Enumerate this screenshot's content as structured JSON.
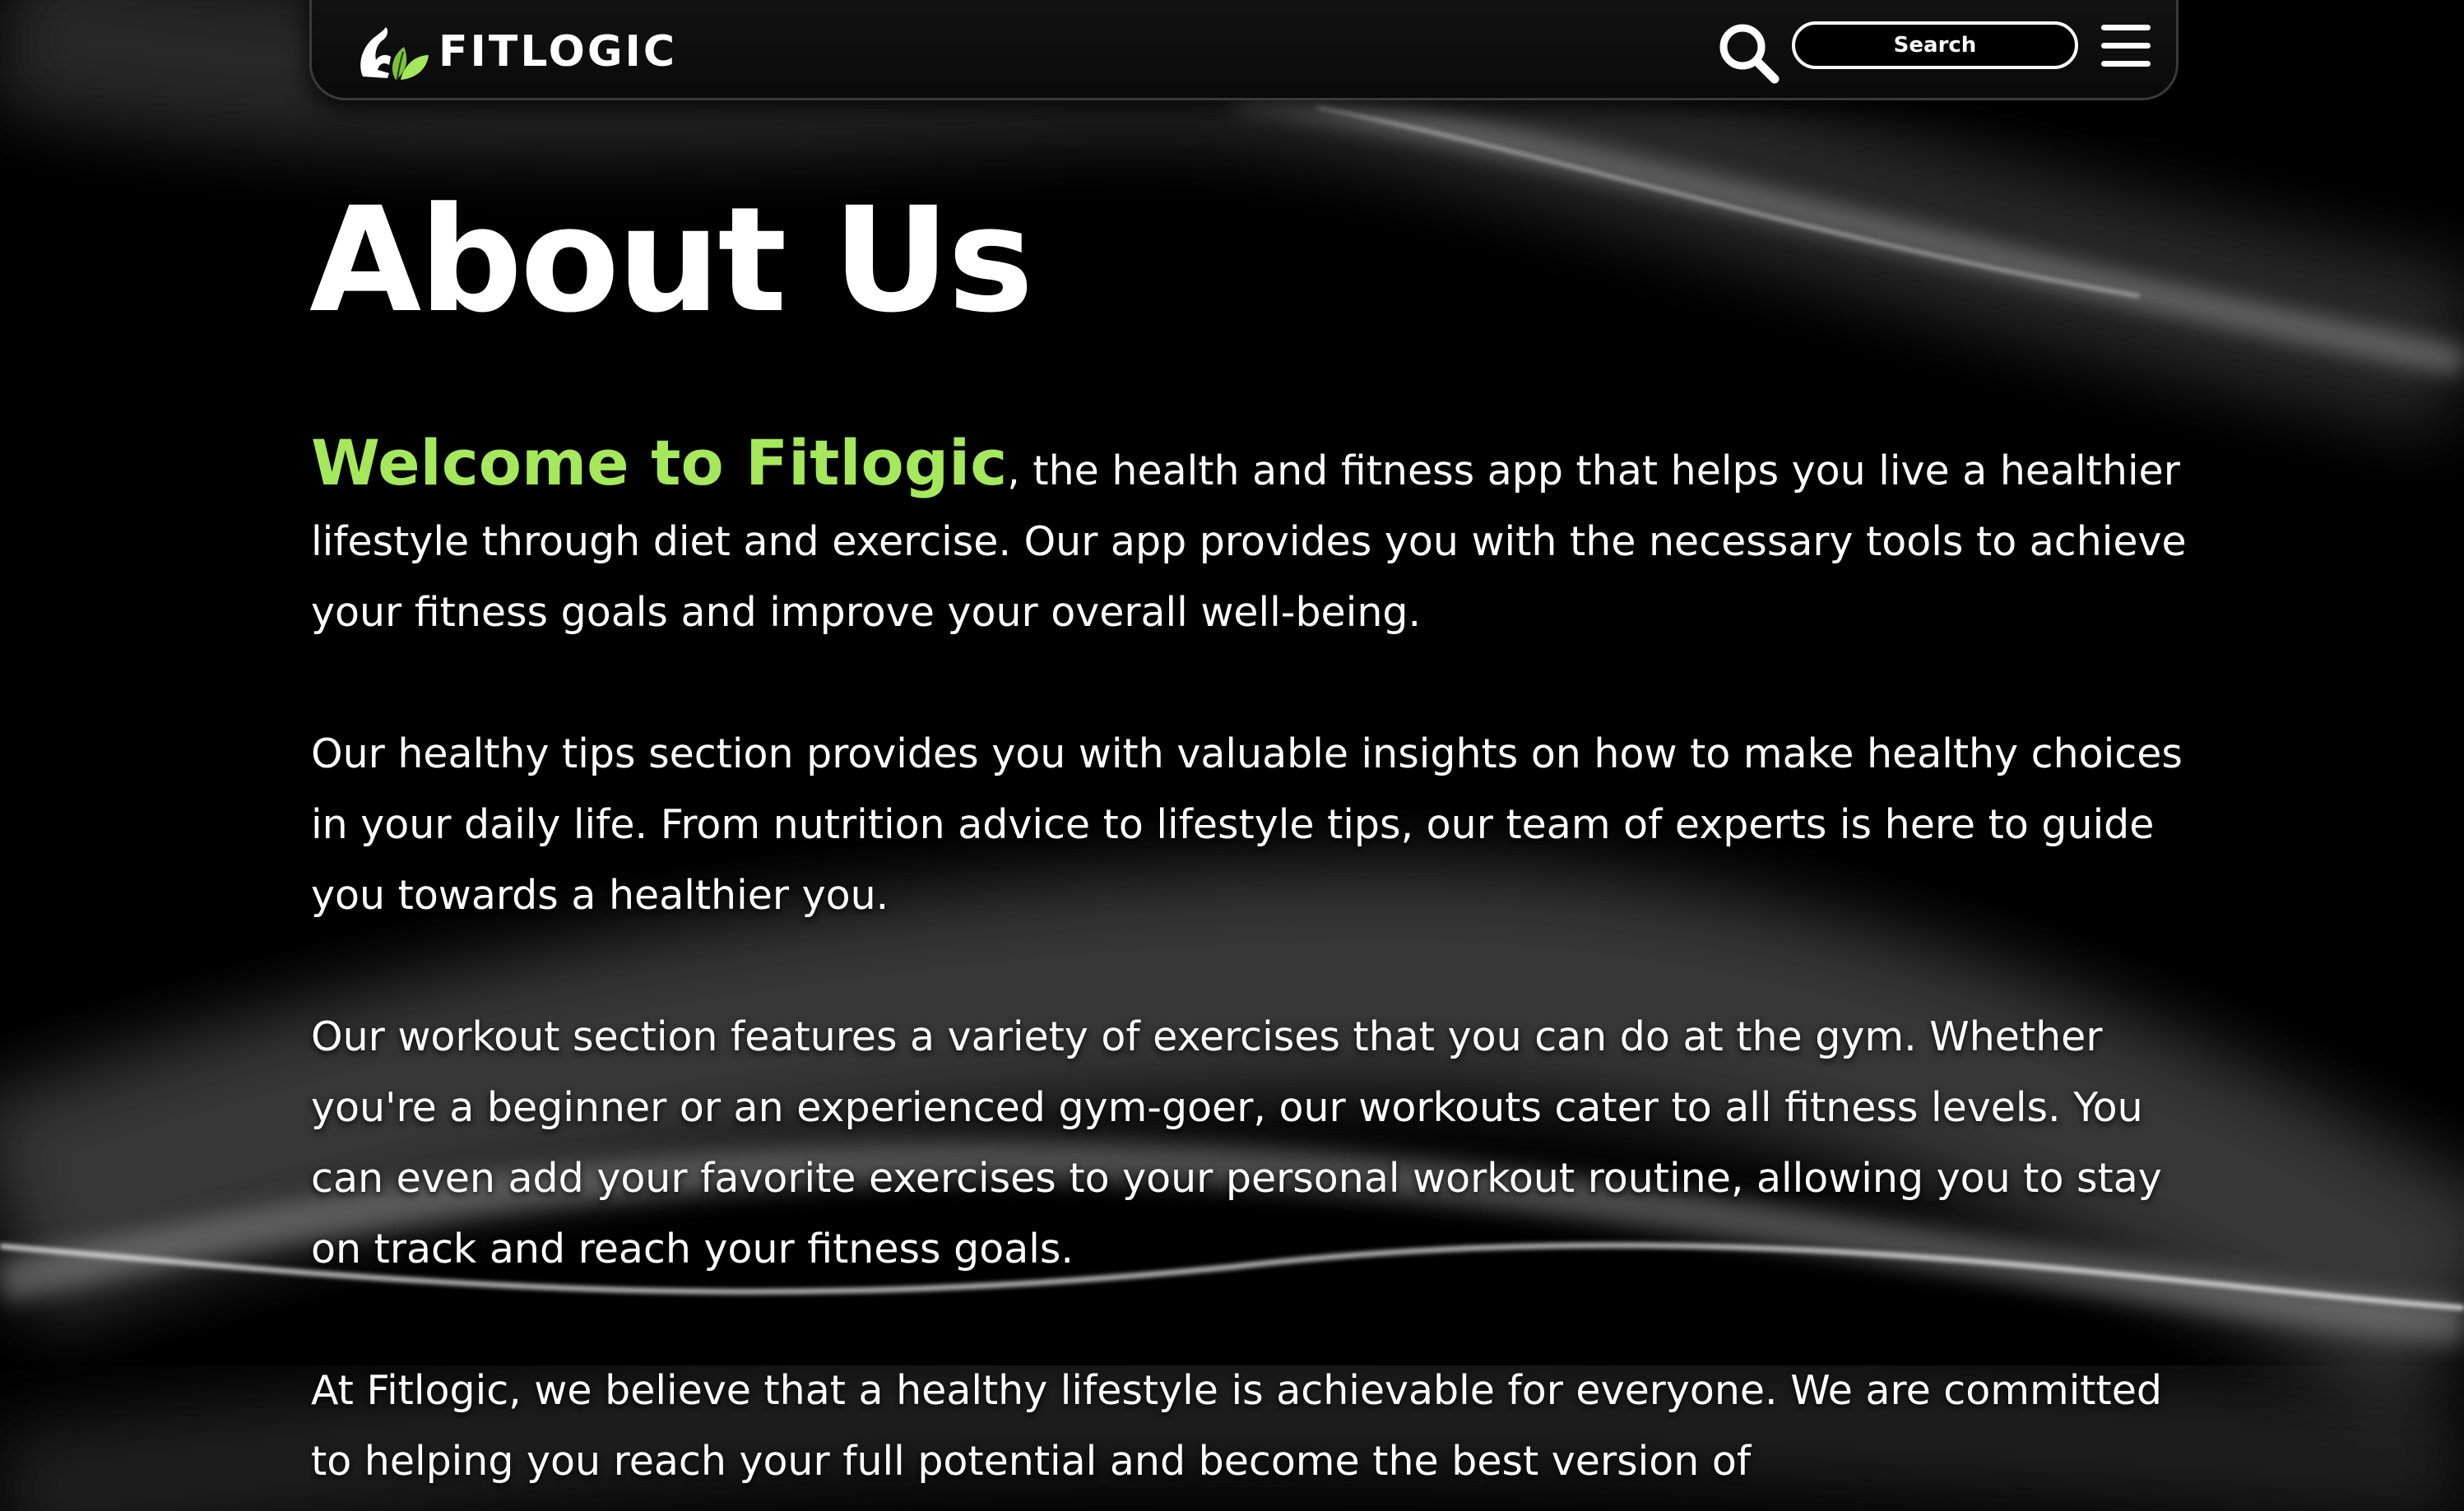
{
  "header": {
    "brand": "FITLOGIC",
    "search_placeholder": "Search",
    "icons": {
      "logo": "flexed-arm-leaf-logo",
      "search": "search-icon",
      "menu": "hamburger-menu-icon"
    }
  },
  "main": {
    "title": "About Us",
    "intro_highlight": "Welcome to Fitlogic",
    "intro_rest": ", the health and fitness app that helps you live a healthier lifestyle through diet and exercise. Our app provides you with the necessary tools to achieve your fitness goals and improve your overall well-being.",
    "paragraphs": [
      "Our healthy tips section provides you with valuable insights on how to make healthy choices in your daily life. From nutrition advice to lifestyle tips, our team of experts is here to guide you towards a healthier you.",
      "Our workout section features a variety of exercises that you can do at the gym. Whether you're a beginner or an experienced gym-goer, our workouts cater to all fitness levels. You can even add your favorite exercises to your personal workout routine, allowing you to stay on track and reach your fitness goals.",
      "At Fitlogic, we believe that a healthy lifestyle is achievable for everyone. We are committed to helping you reach your full potential and become the best version of"
    ]
  },
  "colors": {
    "background": "#000000",
    "text": "#ffffff",
    "accent_green": "#a6e85b"
  }
}
